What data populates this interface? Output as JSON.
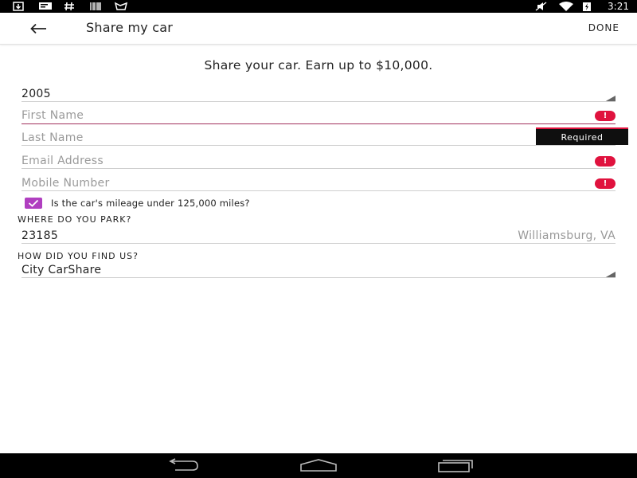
{
  "status_bar": {
    "time": "3:21",
    "left_icons": [
      "download-icon",
      "message-icon",
      "hash-icon",
      "barcode-icon",
      "inbox-icon"
    ],
    "right_icons": [
      "mute-icon",
      "wifi-icon",
      "battery-icon"
    ]
  },
  "app_bar": {
    "title": "Share my car",
    "done_label": "DONE"
  },
  "headline": "Share your car. Earn up to $10,000.",
  "form": {
    "year_value": "2005",
    "first_name_placeholder": "First Name",
    "last_name_placeholder": "Last Name",
    "email_placeholder": "Email Address",
    "mobile_placeholder": "Mobile Number",
    "error_tooltip": "Required",
    "error_glyph": "!",
    "mileage_checked": true,
    "mileage_label": "Is the car's mileage under 125,000 miles?",
    "park_section_label": "WHERE DO YOU PARK?",
    "zip_value": "23185",
    "city_value": "Williamsburg, VA",
    "find_section_label": "HOW DID YOU FIND US?",
    "find_value": "City CarShare"
  },
  "colors": {
    "accent": "#b03fc0",
    "error": "#e0123e",
    "focus_underline": "#a0305c"
  }
}
